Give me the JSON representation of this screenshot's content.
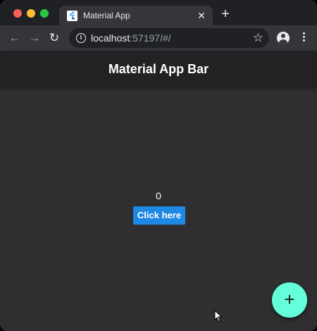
{
  "browser": {
    "tab": {
      "title": "Material App",
      "favicon": "flutter-logo-icon",
      "close_glyph": "✕"
    },
    "new_tab_glyph": "+",
    "toolbar": {
      "back_glyph": "←",
      "forward_glyph": "→",
      "reload_glyph": "↻",
      "star_glyph": "☆"
    },
    "address": {
      "host": "localhost",
      "rest": ":57197/#/"
    }
  },
  "app": {
    "appbar_title": "Material App Bar",
    "counter_value": "0",
    "button_label": "Click here",
    "fab_glyph": "+",
    "colors": {
      "appbar": "#222124",
      "background": "#2f2e31",
      "button": "#1e88e5",
      "fab": "#64ffda"
    }
  }
}
